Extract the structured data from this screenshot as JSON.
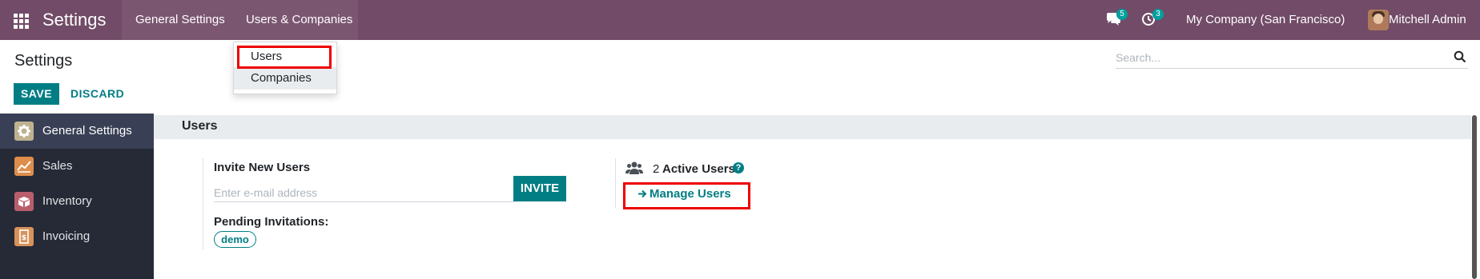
{
  "navbar": {
    "app_title": "Settings",
    "menu": [
      {
        "label": "General Settings"
      },
      {
        "label": "Users & Companies"
      }
    ],
    "chat_badge": "5",
    "activity_badge": "3",
    "company": "My Company (San Francisco)",
    "user": "Mitchell Admin"
  },
  "dropdown": {
    "items": [
      {
        "label": "Users"
      },
      {
        "label": "Companies"
      }
    ]
  },
  "control_panel": {
    "breadcrumb": "Settings",
    "save_label": "SAVE",
    "discard_label": "DISCARD",
    "search_placeholder": "Search..."
  },
  "sidebar": {
    "items": [
      {
        "label": "General Settings",
        "icon": "gear-icon",
        "color": "#bfb38f",
        "active": true
      },
      {
        "label": "Sales",
        "icon": "chart-icon",
        "color": "#dd8e4c",
        "active": false
      },
      {
        "label": "Inventory",
        "icon": "box-icon",
        "color": "#b95e6d",
        "active": false
      },
      {
        "label": "Invoicing",
        "icon": "invoice-icon",
        "color": "#d8925a",
        "active": false
      }
    ]
  },
  "users_section": {
    "title": "Users",
    "invite_title": "Invite New Users",
    "email_placeholder": "Enter e-mail address",
    "invite_label": "INVITE",
    "pending_title": "Pending Invitations:",
    "pending_tags": [
      "demo"
    ],
    "active_count": "2",
    "active_label": "Active Users",
    "help_glyph": "?",
    "manage_label": "Manage Users"
  },
  "colors": {
    "navbar": "#714b67",
    "primary": "#017e84",
    "sidebar": "#262a36",
    "highlight": "#ee0000"
  }
}
